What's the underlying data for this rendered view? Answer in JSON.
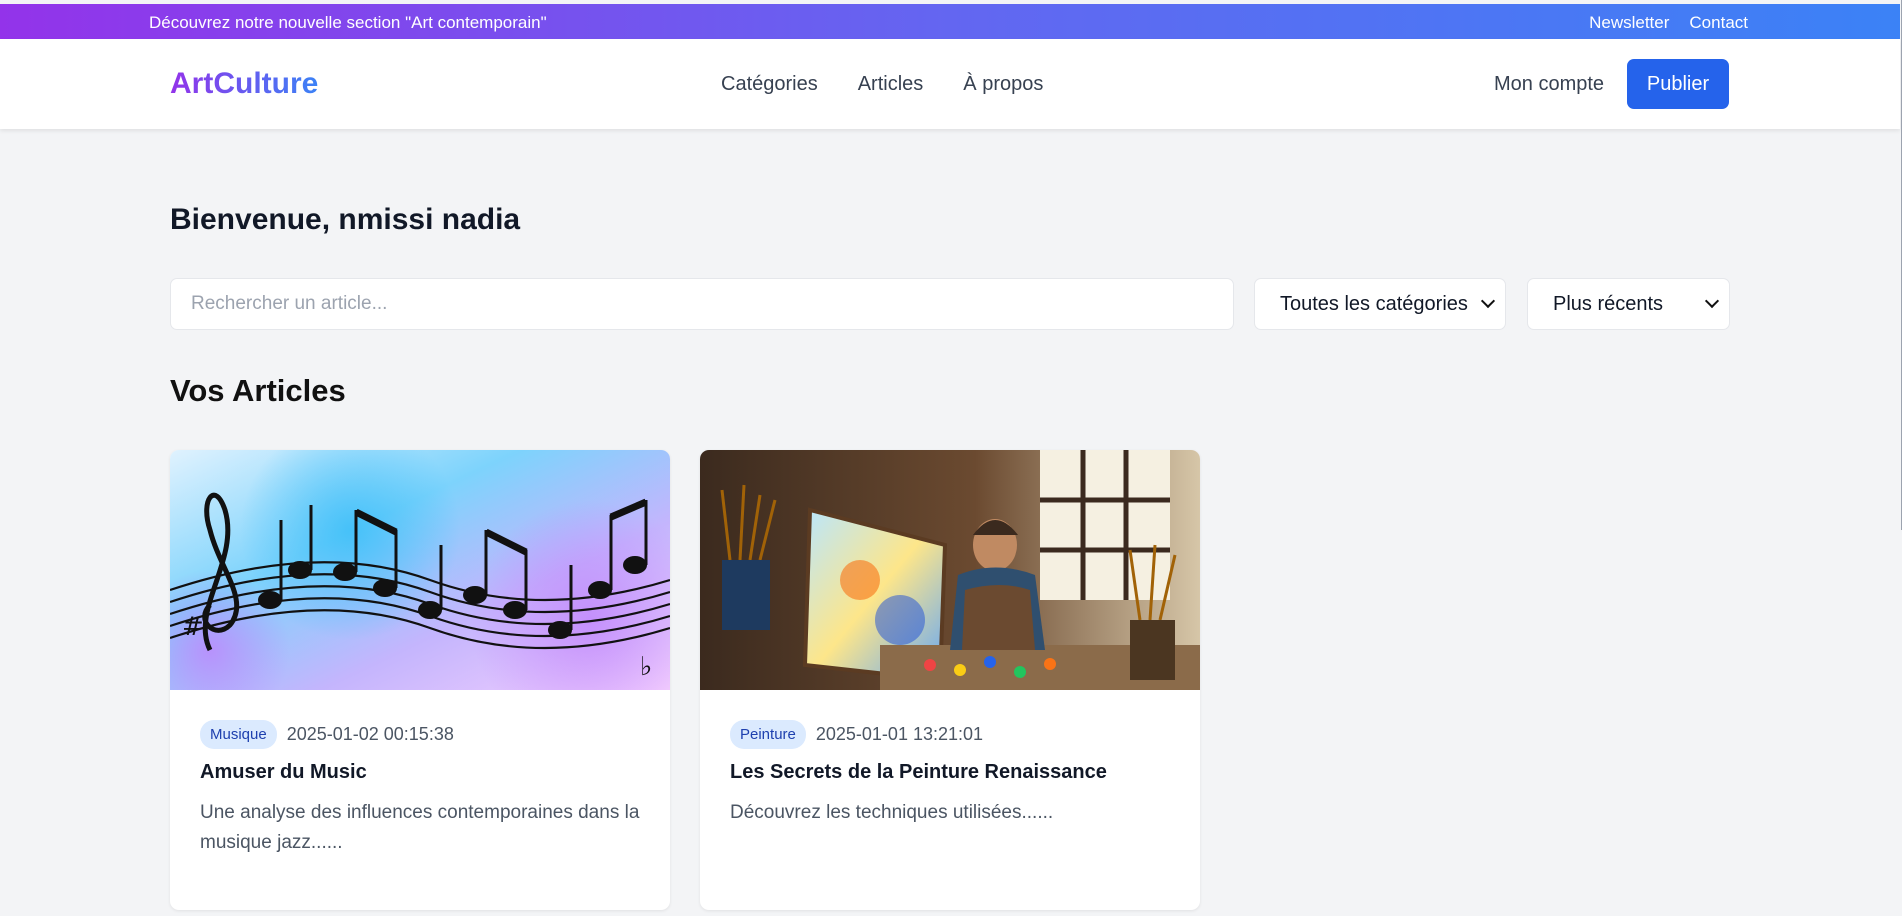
{
  "promo": {
    "message": "Découvrez notre nouvelle section \"Art contemporain\"",
    "links": [
      "Newsletter",
      "Contact"
    ]
  },
  "header": {
    "logo": "ArtCulture",
    "nav": [
      "Catégories",
      "Articles",
      "À propos"
    ],
    "account_label": "Mon compte",
    "publish_label": "Publier"
  },
  "main": {
    "welcome": "Bienvenue, nmissi nadia",
    "search": {
      "placeholder": "Rechercher un article..."
    },
    "category_filter": {
      "selected": "Toutes les catégories"
    },
    "sort_filter": {
      "selected": "Plus récents"
    },
    "section_title": "Vos Articles",
    "articles": [
      {
        "category": "Musique",
        "date": "2025-01-02 00:15:38",
        "title": "Amuser du Music",
        "excerpt": "Une analyse des influences contemporaines dans la musique jazz......",
        "image": "music-notes-watercolor"
      },
      {
        "category": "Peinture",
        "date": "2025-01-01 13:21:01",
        "title": "Les Secrets de la Peinture Renaissance",
        "excerpt": "Découvrez les techniques utilisées......",
        "image": "painter-studio-photo"
      }
    ]
  },
  "colors": {
    "brand_gradient_start": "#9333ea",
    "brand_gradient_end": "#3b82f6",
    "primary_button": "#2563eb",
    "badge_bg": "#dbeafe",
    "badge_text": "#1e40af",
    "page_bg": "#f3f4f6"
  }
}
